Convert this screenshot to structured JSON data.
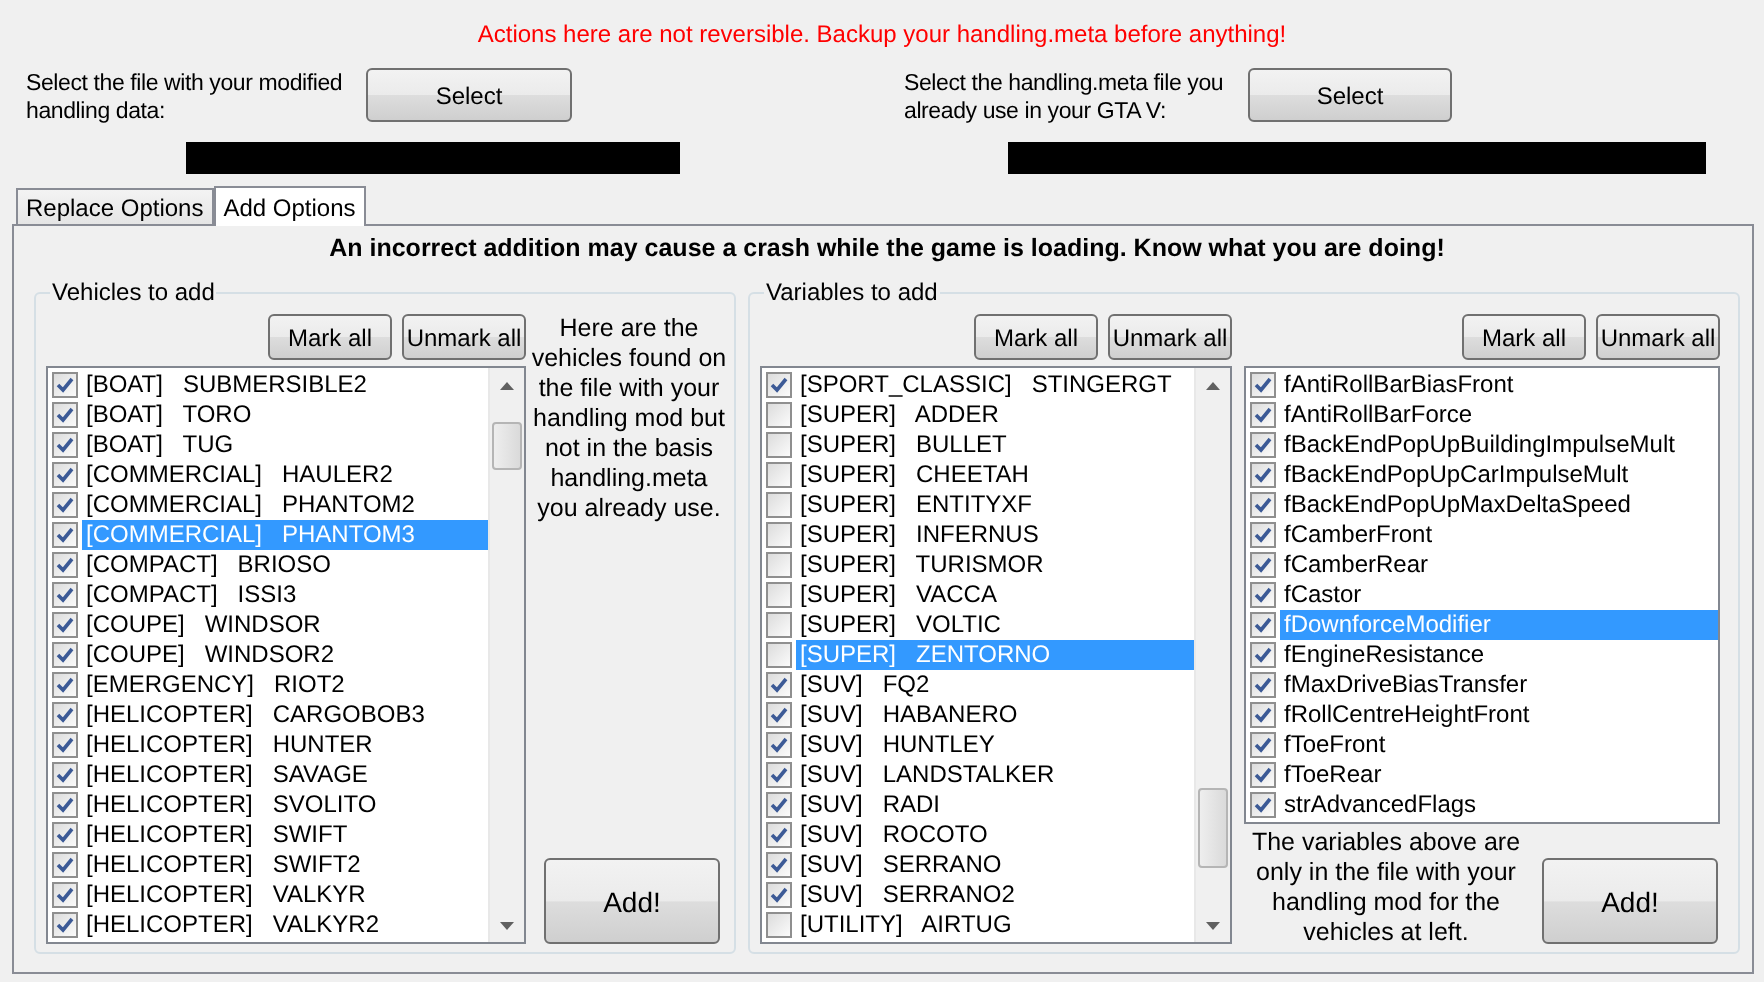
{
  "warning": "Actions here are not reversible. Backup your handling.meta before anything!",
  "file_pickers": [
    {
      "label": "Select the file with your modified handling data:",
      "button": "Select"
    },
    {
      "label": "Select the handling.meta file you already use in your GTA V:",
      "button": "Select"
    }
  ],
  "tabs": [
    {
      "label": "Replace Options",
      "selected": false
    },
    {
      "label": "Add Options",
      "selected": true
    }
  ],
  "notice": "An incorrect addition may cause a crash while the game is loading. Know what you are doing!",
  "vehicles_group": {
    "title": "Vehicles to add",
    "buttons": [
      "Mark all",
      "Unmark all"
    ],
    "items": [
      {
        "label": "[BOAT]   SUBMERSIBLE2",
        "checked": true,
        "selected": false
      },
      {
        "label": "[BOAT]   TORO",
        "checked": true,
        "selected": false
      },
      {
        "label": "[BOAT]   TUG",
        "checked": true,
        "selected": false
      },
      {
        "label": "[COMMERCIAL]   HAULER2",
        "checked": true,
        "selected": false
      },
      {
        "label": "[COMMERCIAL]   PHANTOM2",
        "checked": true,
        "selected": false
      },
      {
        "label": "[COMMERCIAL]   PHANTOM3",
        "checked": true,
        "selected": true
      },
      {
        "label": "[COMPACT]   BRIOSO",
        "checked": true,
        "selected": false
      },
      {
        "label": "[COMPACT]   ISSI3",
        "checked": true,
        "selected": false
      },
      {
        "label": "[COUPE]   WINDSOR",
        "checked": true,
        "selected": false
      },
      {
        "label": "[COUPE]   WINDSOR2",
        "checked": true,
        "selected": false
      },
      {
        "label": "[EMERGENCY]   RIOT2",
        "checked": true,
        "selected": false
      },
      {
        "label": "[HELICOPTER]   CARGOBOB3",
        "checked": true,
        "selected": false
      },
      {
        "label": "[HELICOPTER]   HUNTER",
        "checked": true,
        "selected": false
      },
      {
        "label": "[HELICOPTER]   SAVAGE",
        "checked": true,
        "selected": false
      },
      {
        "label": "[HELICOPTER]   SVOLITO",
        "checked": true,
        "selected": false
      },
      {
        "label": "[HELICOPTER]   SWIFT",
        "checked": true,
        "selected": false
      },
      {
        "label": "[HELICOPTER]   SWIFT2",
        "checked": true,
        "selected": false
      },
      {
        "label": "[HELICOPTER]   VALKYR",
        "checked": true,
        "selected": false
      },
      {
        "label": "[HELICOPTER]   VALKYR2",
        "checked": true,
        "selected": false
      }
    ],
    "hint": "Here are the vehicles found on the file with your handling mod but not in the basis handling.meta you already use.",
    "add_button": "Add!"
  },
  "variables_group": {
    "title": "Variables to add",
    "lists": [
      {
        "buttons": [
          "Mark all",
          "Unmark all"
        ],
        "items": [
          {
            "label": "[SPORT_CLASSIC]   STINGERGT",
            "checked": true,
            "selected": false
          },
          {
            "label": "[SUPER]   ADDER",
            "checked": false,
            "selected": false
          },
          {
            "label": "[SUPER]   BULLET",
            "checked": false,
            "selected": false
          },
          {
            "label": "[SUPER]   CHEETAH",
            "checked": false,
            "selected": false
          },
          {
            "label": "[SUPER]   ENTITYXF",
            "checked": false,
            "selected": false
          },
          {
            "label": "[SUPER]   INFERNUS",
            "checked": false,
            "selected": false
          },
          {
            "label": "[SUPER]   TURISMOR",
            "checked": false,
            "selected": false
          },
          {
            "label": "[SUPER]   VACCA",
            "checked": false,
            "selected": false
          },
          {
            "label": "[SUPER]   VOLTIC",
            "checked": false,
            "selected": false
          },
          {
            "label": "[SUPER]   ZENTORNO",
            "checked": false,
            "selected": true
          },
          {
            "label": "[SUV]   FQ2",
            "checked": true,
            "selected": false
          },
          {
            "label": "[SUV]   HABANERO",
            "checked": true,
            "selected": false
          },
          {
            "label": "[SUV]   HUNTLEY",
            "checked": true,
            "selected": false
          },
          {
            "label": "[SUV]   LANDSTALKER",
            "checked": true,
            "selected": false
          },
          {
            "label": "[SUV]   RADI",
            "checked": true,
            "selected": false
          },
          {
            "label": "[SUV]   ROCOTO",
            "checked": true,
            "selected": false
          },
          {
            "label": "[SUV]   SERRANO",
            "checked": true,
            "selected": false
          },
          {
            "label": "[SUV]   SERRANO2",
            "checked": true,
            "selected": false
          },
          {
            "label": "[UTILITY]   AIRTUG",
            "checked": false,
            "selected": false
          }
        ]
      },
      {
        "buttons": [
          "Mark all",
          "Unmark all"
        ],
        "items": [
          {
            "label": "fAntiRollBarBiasFront",
            "checked": true,
            "selected": false
          },
          {
            "label": "fAntiRollBarForce",
            "checked": true,
            "selected": false
          },
          {
            "label": "fBackEndPopUpBuildingImpulseMult",
            "checked": true,
            "selected": false
          },
          {
            "label": "fBackEndPopUpCarImpulseMult",
            "checked": true,
            "selected": false
          },
          {
            "label": "fBackEndPopUpMaxDeltaSpeed",
            "checked": true,
            "selected": false
          },
          {
            "label": "fCamberFront",
            "checked": true,
            "selected": false
          },
          {
            "label": "fCamberRear",
            "checked": true,
            "selected": false
          },
          {
            "label": "fCastor",
            "checked": true,
            "selected": false
          },
          {
            "label": "fDownforceModifier",
            "checked": true,
            "selected": true
          },
          {
            "label": "fEngineResistance",
            "checked": true,
            "selected": false
          },
          {
            "label": "fMaxDriveBiasTransfer",
            "checked": true,
            "selected": false
          },
          {
            "label": "fRollCentreHeightFront",
            "checked": true,
            "selected": false
          },
          {
            "label": "fToeFront",
            "checked": true,
            "selected": false
          },
          {
            "label": "fToeRear",
            "checked": true,
            "selected": false
          },
          {
            "label": "strAdvancedFlags",
            "checked": true,
            "selected": false
          }
        ]
      }
    ],
    "hint": "The variables above are only in the file with your handling mod for the vehicles at left.",
    "add_button": "Add!"
  }
}
